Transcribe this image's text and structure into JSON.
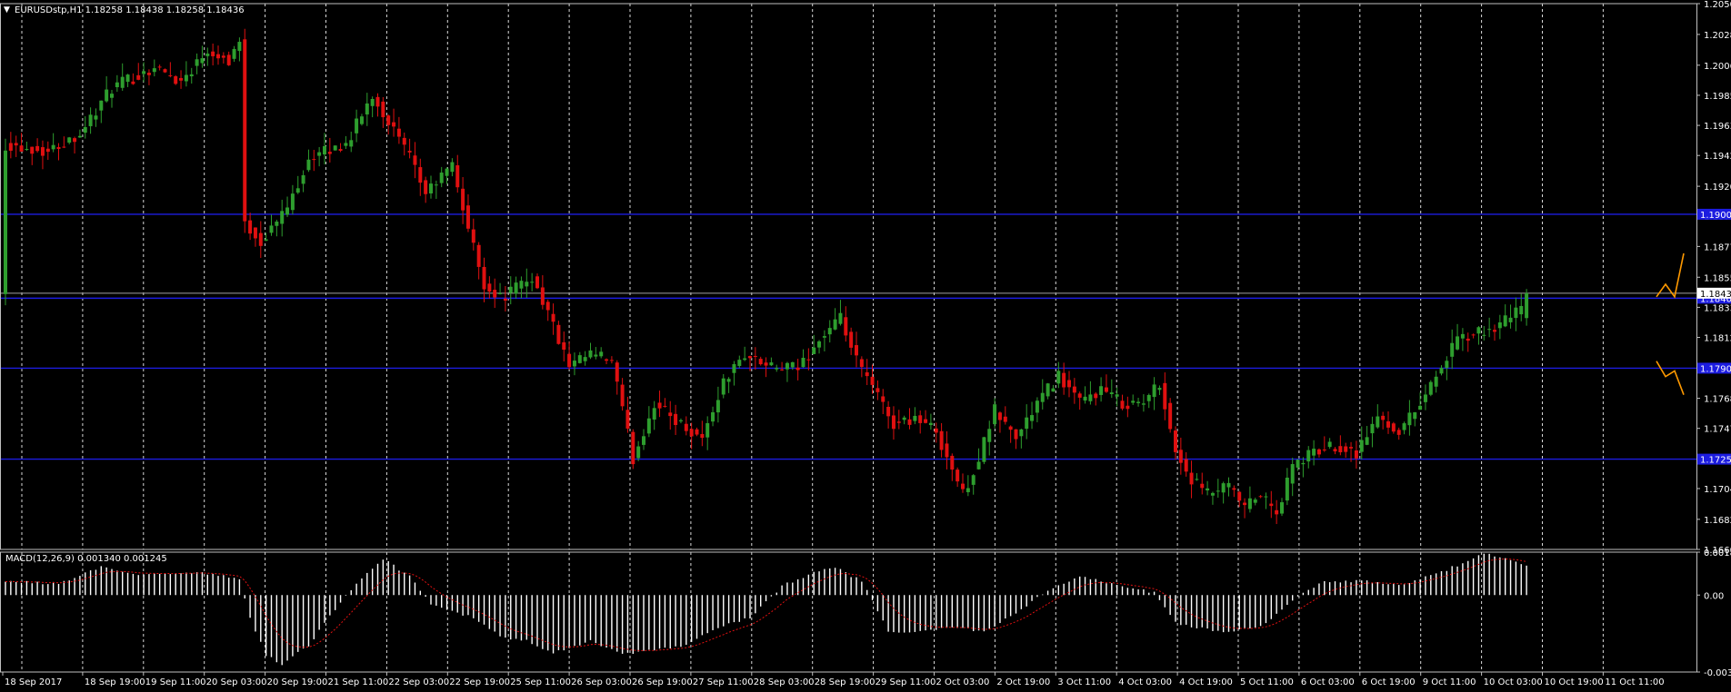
{
  "symbol_info": "EURUSDstp,H1  1.18258 1.18438 1.18258 1.18436",
  "macd_info": "MACD(12,26,9) 0.001340 0.001245",
  "colors": {
    "background": "#000000",
    "frame": "#c0c0c0",
    "grid": "#ffffff",
    "bull": "#2e9e2e",
    "bear": "#e01010",
    "level_line": "#1c1ce0",
    "bid_line": "#a0a0a0",
    "price_tag_fill": "#1c1ce0",
    "text": "#ffffff",
    "signal": "#e01010",
    "arrow": "#ff9900"
  },
  "chart_data": [
    {
      "type": "candlestick",
      "title": "EURUSDstp,H1  1.18258 1.18438 1.18258 1.18436",
      "timeframe": "H1",
      "ylim": [
        1.16605,
        1.20505
      ],
      "y_ticks": [
        "1.20505",
        "1.20285",
        "1.20065",
        "1.19850",
        "1.19635",
        "1.19420",
        "1.19200",
        "1.18985",
        "1.18770",
        "1.18550",
        "1.18335",
        "1.18120",
        "1.17900",
        "1.17685",
        "1.17470",
        "1.17255",
        "1.17040",
        "1.16820",
        "1.16605"
      ],
      "x_ticks": [
        "18 Sep 2017",
        "18 Sep 19:00",
        "19 Sep 11:00",
        "20 Sep 03:00",
        "20 Sep 19:00",
        "21 Sep 11:00",
        "22 Sep 03:00",
        "22 Sep 19:00",
        "25 Sep 11:00",
        "26 Sep 03:00",
        "26 Sep 19:00",
        "27 Sep 11:00",
        "28 Sep 03:00",
        "28 Sep 19:00",
        "29 Sep 11:00",
        "2 Oct 03:00",
        "2 Oct 19:00",
        "3 Oct 11:00",
        "4 Oct 03:00",
        "4 Oct 19:00",
        "5 Oct 11:00",
        "6 Oct 03:00",
        "6 Oct 19:00",
        "9 Oct 11:00",
        "10 Oct 03:00",
        "10 Oct 19:00",
        "11 Oct 11:00"
      ],
      "horizontal_levels": [
        {
          "price": 1.19,
          "label": "1.19000"
        },
        {
          "price": 1.184,
          "label": "1.18400"
        },
        {
          "price": 1.179,
          "label": "1.17900"
        },
        {
          "price": 1.1725,
          "label": "1.17250"
        }
      ],
      "current_price": 1.18436,
      "current_price_label": "1.18436",
      "anchors": [
        [
          0,
          1.195
        ],
        [
          8,
          1.1945
        ],
        [
          14,
          1.1958
        ],
        [
          20,
          1.199
        ],
        [
          28,
          1.2005
        ],
        [
          33,
          1.1995
        ],
        [
          38,
          1.2018
        ],
        [
          42,
          1.201
        ],
        [
          44,
          1.2025
        ],
        [
          45,
          1.1895
        ],
        [
          48,
          1.188
        ],
        [
          53,
          1.1905
        ],
        [
          57,
          1.194
        ],
        [
          64,
          1.195
        ],
        [
          69,
          1.1985
        ],
        [
          73,
          1.196
        ],
        [
          76,
          1.194
        ],
        [
          79,
          1.1915
        ],
        [
          84,
          1.1935
        ],
        [
          87,
          1.189
        ],
        [
          90,
          1.185
        ],
        [
          93,
          1.184
        ],
        [
          99,
          1.1855
        ],
        [
          102,
          1.183
        ],
        [
          106,
          1.179
        ],
        [
          110,
          1.18
        ],
        [
          114,
          1.1795
        ],
        [
          118,
          1.1725
        ],
        [
          122,
          1.1765
        ],
        [
          127,
          1.175
        ],
        [
          131,
          1.174
        ],
        [
          135,
          1.178
        ],
        [
          139,
          1.18
        ],
        [
          144,
          1.179
        ],
        [
          149,
          1.179
        ],
        [
          153,
          1.181
        ],
        [
          157,
          1.1825
        ],
        [
          160,
          1.1795
        ],
        [
          164,
          1.177
        ],
        [
          167,
          1.175
        ],
        [
          171,
          1.1755
        ],
        [
          175,
          1.1745
        ],
        [
          180,
          1.17
        ],
        [
          183,
          1.1725
        ],
        [
          186,
          1.176
        ],
        [
          190,
          1.174
        ],
        [
          194,
          1.1765
        ],
        [
          198,
          1.1785
        ],
        [
          202,
          1.1765
        ],
        [
          206,
          1.1775
        ],
        [
          210,
          1.1765
        ],
        [
          214,
          1.1765
        ],
        [
          217,
          1.178
        ],
        [
          220,
          1.173
        ],
        [
          223,
          1.171
        ],
        [
          226,
          1.17
        ],
        [
          230,
          1.1705
        ],
        [
          233,
          1.169
        ],
        [
          236,
          1.17
        ],
        [
          239,
          1.1685
        ],
        [
          242,
          1.172
        ],
        [
          246,
          1.173
        ],
        [
          250,
          1.1735
        ],
        [
          254,
          1.173
        ],
        [
          258,
          1.1755
        ],
        [
          262,
          1.1745
        ],
        [
          265,
          1.176
        ],
        [
          269,
          1.1785
        ],
        [
          273,
          1.181
        ],
        [
          277,
          1.1815
        ],
        [
          281,
          1.182
        ],
        [
          284,
          1.183
        ],
        [
          286,
          1.1844
        ]
      ],
      "forecast_arrows": [
        {
          "direction": "up",
          "points": [
            [
              1.1841,
              0
            ],
            [
              1.185,
              1
            ],
            [
              1.1841,
              2
            ],
            [
              1.1872,
              3
            ]
          ]
        },
        {
          "direction": "down",
          "points": [
            [
              1.1795,
              0
            ],
            [
              1.1784,
              1
            ],
            [
              1.1788,
              2
            ],
            [
              1.1771,
              3
            ]
          ]
        }
      ]
    },
    {
      "type": "macd",
      "title": "MACD(12,26,9) 0.001340 0.001245",
      "params": [
        12,
        26,
        9
      ],
      "macd_value": 0.00134,
      "signal_value": 0.001245,
      "ylim": [
        -0.00335,
        0.001868
      ],
      "y_ticks": [
        "0.001868",
        "0.00",
        "-0.00335"
      ],
      "anchors": [
        [
          0,
          0.0006
        ],
        [
          10,
          0.0005
        ],
        [
          18,
          0.0012
        ],
        [
          24,
          0.0009
        ],
        [
          36,
          0.001
        ],
        [
          44,
          0.0007
        ],
        [
          46,
          -0.001
        ],
        [
          49,
          -0.0026
        ],
        [
          52,
          -0.003
        ],
        [
          57,
          -0.0022
        ],
        [
          62,
          -0.0006
        ],
        [
          68,
          0.001
        ],
        [
          71,
          0.0016
        ],
        [
          76,
          0.0008
        ],
        [
          80,
          -0.0004
        ],
        [
          88,
          -0.001
        ],
        [
          93,
          -0.0018
        ],
        [
          98,
          -0.002
        ],
        [
          103,
          -0.0025
        ],
        [
          110,
          -0.002
        ],
        [
          116,
          -0.0026
        ],
        [
          122,
          -0.0024
        ],
        [
          128,
          -0.0022
        ],
        [
          134,
          -0.0014
        ],
        [
          140,
          -0.001
        ],
        [
          146,
          0.0004
        ],
        [
          152,
          0.001
        ],
        [
          156,
          0.0012
        ],
        [
          161,
          0.0006
        ],
        [
          166,
          -0.0016
        ],
        [
          172,
          -0.0016
        ],
        [
          178,
          -0.0014
        ],
        [
          184,
          -0.0016
        ],
        [
          190,
          -0.0008
        ],
        [
          196,
          0.0002
        ],
        [
          202,
          0.0008
        ],
        [
          210,
          0.0004
        ],
        [
          216,
          0.0001
        ],
        [
          220,
          -0.0012
        ],
        [
          228,
          -0.0016
        ],
        [
          236,
          -0.0014
        ],
        [
          242,
          -0.0002
        ],
        [
          248,
          0.0006
        ],
        [
          256,
          0.0006
        ],
        [
          262,
          0.0004
        ],
        [
          270,
          0.001
        ],
        [
          278,
          0.0018
        ],
        [
          286,
          0.00134
        ]
      ]
    }
  ]
}
